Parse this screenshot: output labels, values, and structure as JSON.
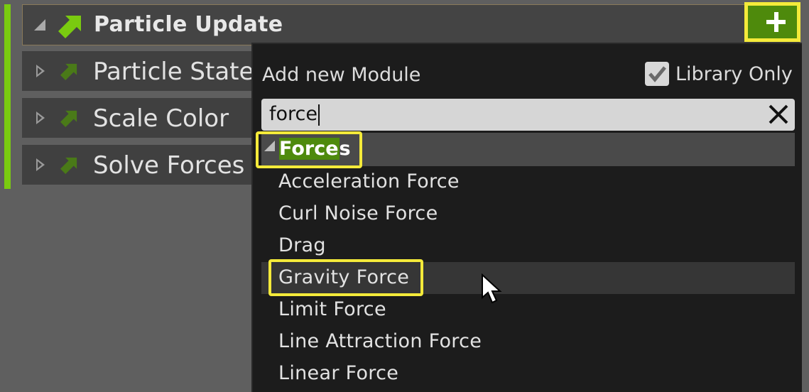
{
  "header": {
    "title": "Particle Update",
    "add_button_icon": "plus-icon",
    "expand_icon": "collapse-triangle-icon",
    "module_icon": "arrow-up-right-icon"
  },
  "modules": [
    {
      "label": "Particle State"
    },
    {
      "label": "Scale Color"
    },
    {
      "label": "Solve Forces"
    }
  ],
  "popup": {
    "title": "Add new Module",
    "library_only_label": "Library Only",
    "library_only_checked": true,
    "search": {
      "value": "force",
      "clear_icon": "close-icon"
    },
    "category": {
      "label": "Forces",
      "match_part": "Force",
      "rest_part": "s"
    },
    "items": [
      {
        "label": "Acceleration Force"
      },
      {
        "label": "Curl Noise Force"
      },
      {
        "label": "Drag"
      },
      {
        "label": "Gravity Force"
      },
      {
        "label": "Limit Force"
      },
      {
        "label": "Line Attraction Force"
      },
      {
        "label": "Linear Force"
      }
    ],
    "hovered_item": "Gravity Force"
  },
  "colors": {
    "accent_green": "#7acb10",
    "highlight_yellow": "#f4ea3a",
    "background": "#5f5f5f",
    "popup_bg": "#1c1c1c"
  }
}
